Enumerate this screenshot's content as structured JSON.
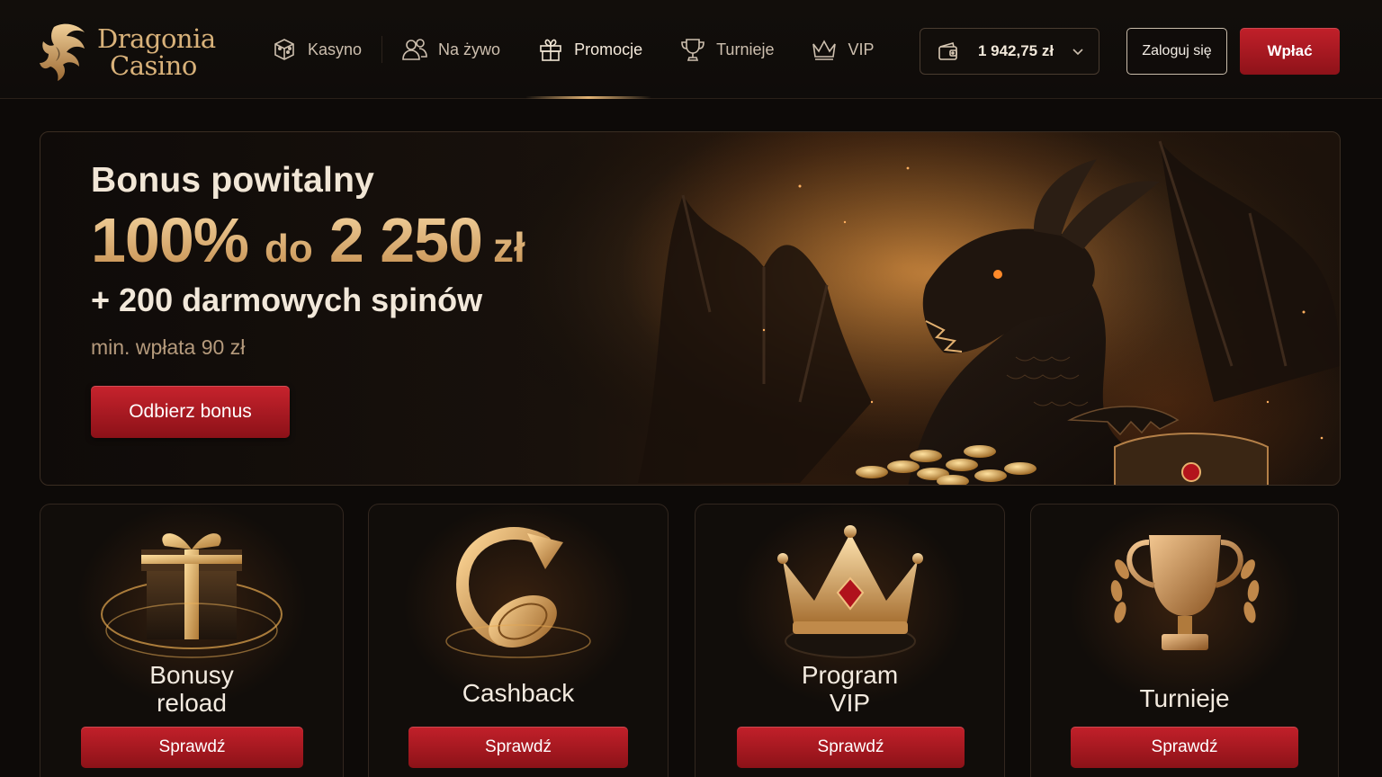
{
  "brand": {
    "line1": "Dragonia",
    "line2": "Casino"
  },
  "nav": [
    {
      "label": "Kasyno",
      "icon": "dice-icon",
      "active": false
    },
    {
      "label": "Na żywo",
      "icon": "users-icon",
      "active": false
    },
    {
      "label": "Promocje",
      "icon": "gift-icon",
      "active": true
    },
    {
      "label": "Turnieje",
      "icon": "trophy-icon",
      "active": false
    },
    {
      "label": "VIP",
      "icon": "crown-icon",
      "active": false
    }
  ],
  "wallet": {
    "balance": "1 942,75 zł",
    "icon": "wallet-icon"
  },
  "auth": {
    "login_label": "Zaloguj się",
    "deposit_label": "Wpłać"
  },
  "hero": {
    "label": "Bonus powitalny",
    "amount_percent": "100%",
    "amount_to": "do",
    "amount_value": "2 250",
    "amount_currency": "zł",
    "spins": "+ 200 darmowych spinów",
    "min_deposit": "min. wpłata 90 zł",
    "cta": "Odbierz bonus"
  },
  "cards": [
    {
      "title_l1": "Bonusy",
      "title_l2": "reload",
      "button": "Sprawdź",
      "icon": "gift-box-icon"
    },
    {
      "title_l1": "Cashback",
      "title_l2": "",
      "button": "Sprawdź",
      "icon": "cashback-coin-icon"
    },
    {
      "title_l1": "Program",
      "title_l2": "VIP",
      "button": "Sprawdź",
      "icon": "vip-crown-icon"
    },
    {
      "title_l1": "Turnieje",
      "title_l2": "",
      "button": "Sprawdź",
      "icon": "trophy-cup-icon"
    }
  ],
  "colors": {
    "accent_gold": "#d9b27a",
    "cta_red": "#b81c25",
    "background": "#0d0a08"
  }
}
